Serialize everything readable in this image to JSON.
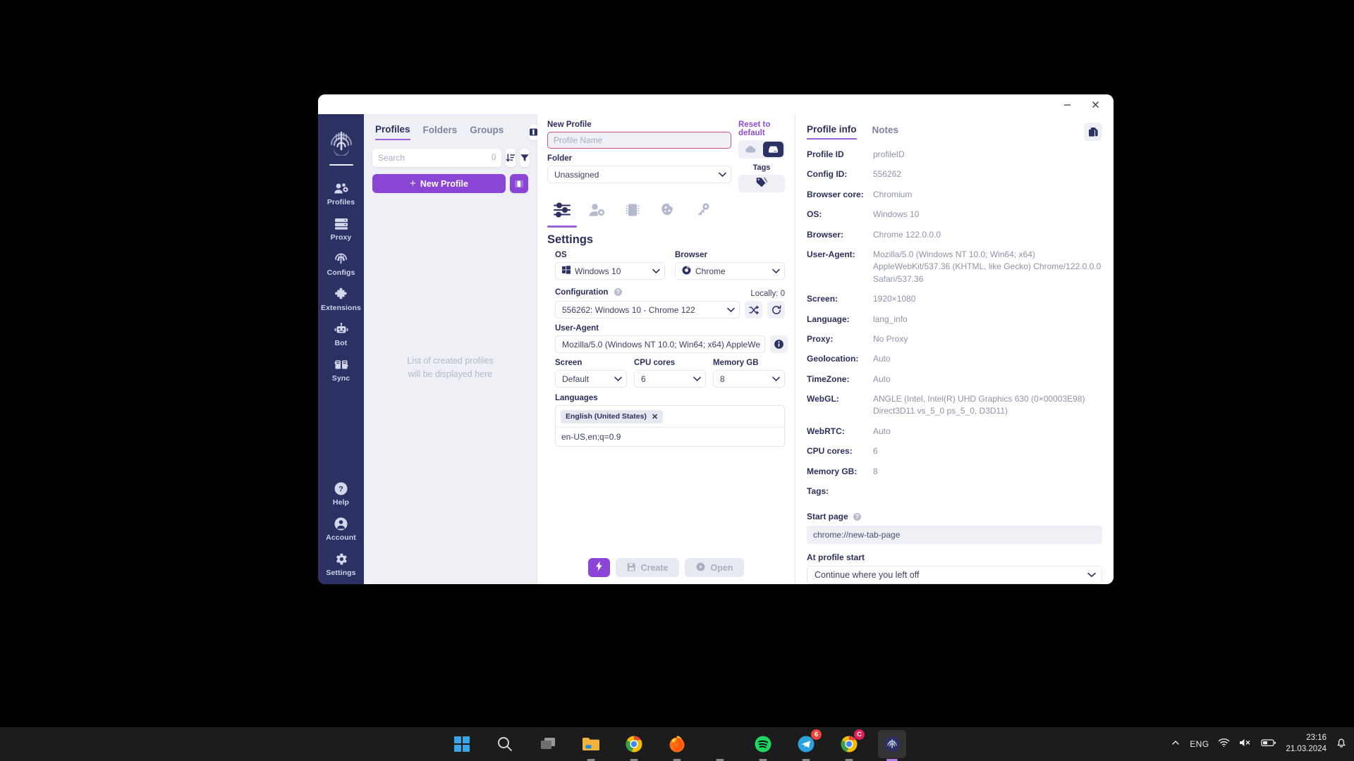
{
  "window": {
    "minimize_label": "Minimize",
    "close_label": "Close"
  },
  "rail": {
    "logo_name": "octo-browser-logo",
    "items": [
      {
        "label": "Profiles",
        "icon": "profiles-icon"
      },
      {
        "label": "Proxy",
        "icon": "proxy-server-icon"
      },
      {
        "label": "Configs",
        "icon": "fingerprint-icon"
      },
      {
        "label": "Extensions",
        "icon": "puzzle-piece-icon"
      },
      {
        "label": "Bot",
        "icon": "robot-icon"
      },
      {
        "label": "Sync",
        "icon": "sync-icon"
      }
    ],
    "bottom_items": [
      {
        "label": "Help",
        "icon": "question-circle-icon"
      },
      {
        "label": "Account",
        "icon": "user-circle-icon"
      },
      {
        "label": "Settings",
        "icon": "gear-icon"
      }
    ]
  },
  "list_panel": {
    "tabs": [
      {
        "label": "Profiles",
        "active": true
      },
      {
        "label": "Folders",
        "active": false
      },
      {
        "label": "Groups",
        "active": false
      }
    ],
    "layout_toggle_icon": "panel-layout-icon",
    "search": {
      "placeholder": "Search",
      "value": "",
      "count": "0"
    },
    "sort_icon": "sort-descending-icon",
    "filter_icon": "filter-icon",
    "new_profile_label": "New Profile",
    "new_profile_plus": "+",
    "side_toggle_icon": "panel-toggle-icon",
    "empty_state_line1": "List of created profiles",
    "empty_state_line2": "will be displayed here"
  },
  "form": {
    "new_profile_label": "New Profile",
    "reset_label": "Reset to default",
    "profile_name": {
      "placeholder": "Profile Name",
      "value": ""
    },
    "folder_label": "Folder",
    "folder_value": "Unassigned",
    "storage_cloud_icon": "cloud-icon",
    "storage_local_icon": "local-storage-icon",
    "tags_label": "Tags",
    "tags_icon": "tag-icon",
    "icon_tabs": [
      {
        "icon": "sliders-settings-icon",
        "active": true
      },
      {
        "icon": "user-settings-icon",
        "active": false
      },
      {
        "icon": "cpu-chip-icon",
        "active": false
      },
      {
        "icon": "cookie-icon",
        "active": false
      },
      {
        "icon": "key-icon",
        "active": false
      }
    ],
    "section_title": "Settings",
    "os_label": "OS",
    "os_value": "Windows 10",
    "os_icon": "windows-logo-icon",
    "browser_label": "Browser",
    "browser_value": "Chrome",
    "browser_icon": "chrome-logo-icon",
    "configuration_label": "Configuration",
    "configuration_help": "?",
    "locally_label": "Locally: 0",
    "configuration_value": "556262: Windows 10 - Chrome 122",
    "shuffle_icon": "shuffle-icon",
    "refresh_icon": "refresh-icon",
    "user_agent_label": "User-Agent",
    "user_agent_value": "Mozilla/5.0 (Windows NT 10.0; Win64; x64) AppleWe",
    "info_icon": "info-icon",
    "screen_label": "Screen",
    "screen_value": "Default",
    "cpu_label": "CPU cores",
    "cpu_value": "6",
    "memory_label": "Memory GB",
    "memory_value": "8",
    "languages_label": "Languages",
    "language_chip": "English (United States)",
    "language_chip_remove": "✕",
    "accept_language": "en-US,en;q=0.9",
    "quick_action_icon": "lightning-bolt-icon",
    "create_label": "Create",
    "create_icon": "save-disk-icon",
    "open_label": "Open",
    "open_icon": "play-circle-icon"
  },
  "info": {
    "tabs": [
      {
        "label": "Profile info",
        "active": true
      },
      {
        "label": "Notes",
        "active": false
      }
    ],
    "copy_icon": "copy-icon",
    "rows": [
      {
        "key": "Profile ID",
        "value": "profileID"
      },
      {
        "key": "Config ID:",
        "value": "556262"
      },
      {
        "key": "Browser core:",
        "value": "Chromium"
      },
      {
        "key": "OS:",
        "value": "Windows 10"
      },
      {
        "key": "Browser:",
        "value": "Chrome 122.0.0.0"
      },
      {
        "key": "User-Agent:",
        "value": "Mozilla/5.0 (Windows NT 10.0; Win64; x64) AppleWebKit/537.36 (KHTML, like Gecko) Chrome/122.0.0.0 Safari/537.36"
      },
      {
        "key": "Screen:",
        "value": "1920×1080"
      },
      {
        "key": "Language:",
        "value": "lang_info"
      },
      {
        "key": "Proxy:",
        "value": "No Proxy"
      },
      {
        "key": "Geolocation:",
        "value": "Auto"
      },
      {
        "key": "TimeZone:",
        "value": "Auto"
      },
      {
        "key": "WebGL:",
        "value": "ANGLE (Intel, Intel(R) UHD Graphics 630 (0×00003E98) Direct3D11 vs_5_0 ps_5_0, D3D11)"
      },
      {
        "key": "WebRTC:",
        "value": "Auto"
      },
      {
        "key": "CPU cores:",
        "value": "6"
      },
      {
        "key": "Memory GB:",
        "value": "8"
      },
      {
        "key": "Tags:",
        "value": ""
      }
    ],
    "start_page_label": "Start page",
    "start_page_help": "?",
    "start_page_value": "chrome://new-tab-page",
    "at_profile_start_label": "At profile start",
    "at_profile_start_value": "Continue where you left off"
  },
  "taskbar": {
    "apps": [
      {
        "name": "start-button-icon",
        "dot": false
      },
      {
        "name": "search-icon",
        "dot": false
      },
      {
        "name": "task-view-icon",
        "dot": false
      },
      {
        "name": "file-explorer-icon",
        "dot": true
      },
      {
        "name": "chrome-icon",
        "dot": true
      },
      {
        "name": "firefox-icon",
        "dot": true
      },
      {
        "name": "unknown-app-icon",
        "dot": true
      },
      {
        "name": "spotify-icon",
        "dot": true
      },
      {
        "name": "telegram-icon",
        "dot": true,
        "badge": "6",
        "badge_color": "#e8453c"
      },
      {
        "name": "chrome-canary-icon",
        "dot": true,
        "badge": "C",
        "badge_color": "#e01e5a"
      },
      {
        "name": "octo-browser-icon",
        "dot": true,
        "active": true
      }
    ],
    "chevron_icon": "chevron-up-icon",
    "language": "ENG",
    "wifi_icon": "wifi-icon",
    "volume_icon": "volume-muted-icon",
    "battery_icon": "battery-icon",
    "time": "23:16",
    "date": "21.03.2024",
    "notification_icon": "bell-icon"
  },
  "colors": {
    "accent_purple": "#8b45d5",
    "navy": "#2c3164",
    "tab_underline": "#9a62d6",
    "error_border": "#d6527e"
  }
}
